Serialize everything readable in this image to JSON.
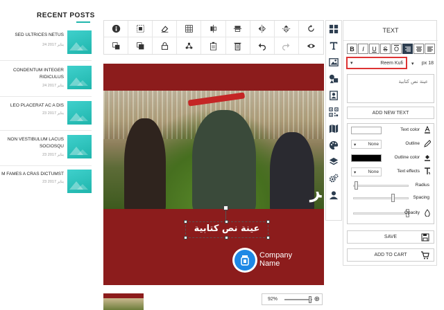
{
  "sidebar": {
    "title": "RECENT POSTS",
    "posts": [
      {
        "title": "SED ULTRICES NETUS",
        "date": "24 يناير 2017"
      },
      {
        "title": "CONDENTUM INTEGER RIDICULUS",
        "date": "24 يناير 2017"
      },
      {
        "title": "LEO PLACERAT AC A DIS",
        "date": "23 يناير 2017"
      },
      {
        "title": "NON VESTIBULUM LACUS SOCIOSQU",
        "date": "23 يناير 2017"
      },
      {
        "title": "M FAMES A CRAS DICTUMST",
        "date": "23 يناير 2017"
      }
    ]
  },
  "canvas": {
    "text_layer": "عينة نص كتابية",
    "photo_overlay_letter": "ﺮ",
    "logo_line1": "Company",
    "logo_line2": "Name",
    "background_color": "#8c1c1c"
  },
  "zoom": {
    "value": "92%",
    "level_percent": 92
  },
  "panel": {
    "title": "TEXT",
    "format_buttons": [
      "B",
      "I",
      "U",
      "S",
      "O"
    ],
    "font_name": "Reem Kufi",
    "font_size": "px 18",
    "text_value": "عينة نص كتابية",
    "add_text_label": "ADD NEW TEXT",
    "properties": {
      "text_color_label": "Text color",
      "outline_label": "Outline",
      "outline_value": "None",
      "outline_color_label": "Outline color",
      "text_effects_label": "Text effects",
      "text_effects_value": "None",
      "radius_label": "Radius",
      "spacing_label": "Spacing",
      "opacity_label": "Opacity",
      "text_color": "#ffffff",
      "outline_color": "#000000",
      "radius_level": 0.02,
      "spacing_level": 0.72,
      "opacity_level": 1.0
    },
    "save_label": "SAVE",
    "cart_label": "ADD TO CART"
  },
  "colors": {
    "accent": "#1fb5ac",
    "dark": "#2d3e50",
    "highlight": "#dd3333"
  }
}
